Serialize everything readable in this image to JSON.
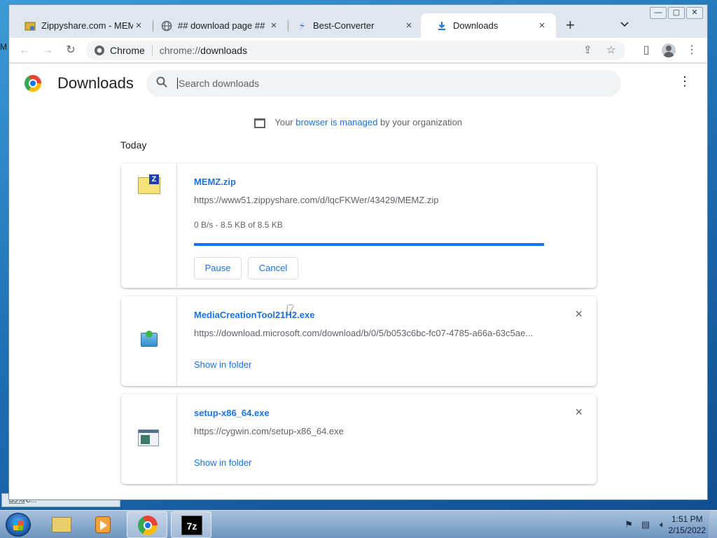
{
  "desktop": {
    "left_text": "M",
    "strip_text": "35% C..."
  },
  "tabs": [
    {
      "title": "Zippyshare.com - MEMZ",
      "close": "×",
      "icon": "zippyshare-icon"
    },
    {
      "title": "## download page ##",
      "close": "×",
      "icon": "globe-icon"
    },
    {
      "title": "Best-Converter",
      "close": "×",
      "icon": "converter-s-icon"
    },
    {
      "title": "Downloads",
      "close": "×",
      "icon": "download-icon"
    }
  ],
  "new_tab": "+",
  "tab_menu": "⌄",
  "window_controls": {
    "minimize": "—",
    "maximize": "▢",
    "close": "✕"
  },
  "toolbar": {
    "back": "←",
    "forward": "→",
    "reload": "↻",
    "site_label": "Chrome",
    "url_prefix": "chrome://",
    "url_path": "downloads",
    "share": "⇪",
    "bookmark": "☆",
    "sidepanel": "▯",
    "menu": "⋮"
  },
  "page": {
    "title": "Downloads",
    "search_placeholder": "Search downloads",
    "menu": "⋮",
    "managed_prefix": "Your",
    "managed_link": "browser is managed",
    "managed_suffix": "by your organization",
    "section_today": "Today"
  },
  "downloads": [
    {
      "name": "MEMZ.zip",
      "url": "https://www51.zippyshare.com/d/lqcFKWer/43429/MEMZ.zip",
      "status": "0 B/s - 8.5 KB of 8.5 KB",
      "progress": 1.0,
      "pause_label": "Pause",
      "cancel_label": "Cancel"
    },
    {
      "name": "MediaCreationTool21H2.exe",
      "url": "https://download.microsoft.com/download/b/0/5/b053c6bc-fc07-4785-a66a-63c5ae...",
      "link": "Show in folder",
      "close": "×"
    },
    {
      "name": "setup-x86_64.exe",
      "url": "https://cygwin.com/setup-x86_64.exe",
      "link": "Show in folder",
      "close": "×"
    }
  ],
  "taskbar": {
    "apps": [
      "explorer",
      "media-player",
      "chrome",
      "7-zip"
    ],
    "seven_zip_label": "7z",
    "time": "1:51 PM",
    "date": "2/15/2022"
  },
  "colors": {
    "accent": "#1a73e8",
    "text": "#202124",
    "secondary": "#5f6368"
  }
}
